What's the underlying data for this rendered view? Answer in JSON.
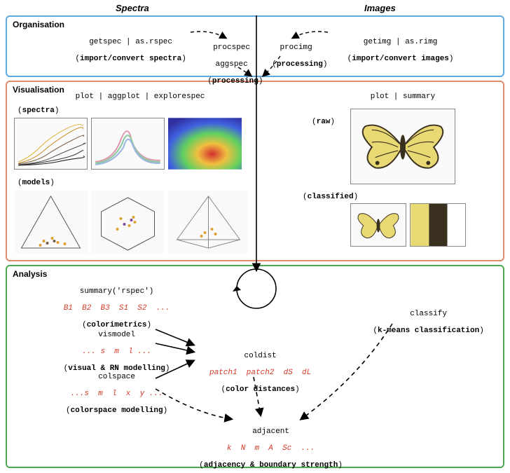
{
  "headers": {
    "spectra": "Spectra",
    "images": "Images"
  },
  "sections": {
    "org": "Organisation",
    "vis": "Visualisation",
    "an": "Analysis"
  },
  "org": {
    "getspec": {
      "fn": "getspec | as.rspec",
      "desc": "import/convert spectra"
    },
    "procspec": {
      "fn1": "procspec",
      "fn2": "aggspec",
      "desc": "processing"
    },
    "procimg": {
      "fn": "procimg",
      "desc": "processing"
    },
    "getimg": {
      "fn": "getimg | as.rimg",
      "desc": "import/convert images"
    }
  },
  "vis": {
    "spectra_fn": "plot | aggplot | explorespec",
    "spectra_lbl": "spectra",
    "models_lbl": "models",
    "images_fn": "plot | summary",
    "raw_lbl": "raw",
    "classified_lbl": "classified"
  },
  "an": {
    "summary": {
      "fn": "summary('rspec')",
      "vars": "B1  B2  B3  S1  S2  ...",
      "desc": "colorimetrics"
    },
    "vismodel": {
      "fn": "vismodel",
      "vars": "... s  m  l ...",
      "desc": "visual & RN modelling"
    },
    "colspace": {
      "fn": "colspace",
      "vars": "...s  m  l  x  y ...",
      "desc": "colorspace modelling"
    },
    "coldist": {
      "fn": "coldist",
      "vars": "patch1  patch2  dS  dL",
      "desc": "color distances"
    },
    "adjacent": {
      "fn": "adjacent",
      "vars": "k  N  m  A  Sc  ...",
      "desc": "adjacency & boundary strength"
    },
    "classify": {
      "fn": "classify",
      "desc": "k-means classification"
    }
  }
}
